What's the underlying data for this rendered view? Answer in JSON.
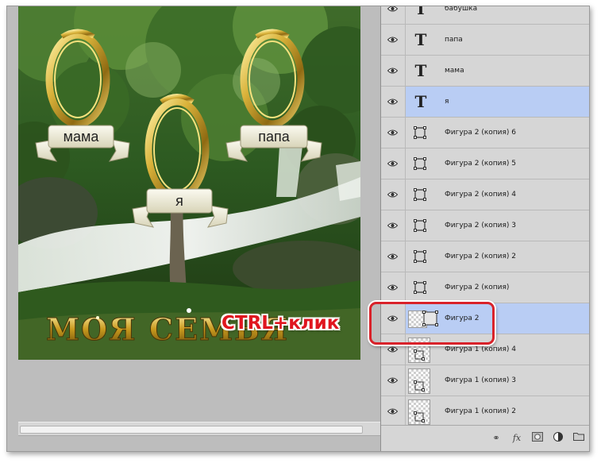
{
  "canvas": {
    "frame_labels": [
      "мама",
      "я",
      "папа"
    ],
    "title_text": "МОЯ СЕМЬЯ"
  },
  "annotation": {
    "shortcut_text": "CTRL+клик"
  },
  "layers": [
    {
      "name": "бабушка",
      "kind": "text",
      "selected": false
    },
    {
      "name": "папа",
      "kind": "text",
      "selected": false
    },
    {
      "name": "мама",
      "kind": "text",
      "selected": false
    },
    {
      "name": "я",
      "kind": "text",
      "selected": true
    },
    {
      "name": "Фигура 2 (копия) 6",
      "kind": "shape",
      "selected": false
    },
    {
      "name": "Фигура 2 (копия) 5",
      "kind": "shape",
      "selected": false
    },
    {
      "name": "Фигура 2 (копия) 4",
      "kind": "shape",
      "selected": false
    },
    {
      "name": "Фигура 2 (копия) 3",
      "kind": "shape",
      "selected": false
    },
    {
      "name": "Фигура 2 (копия) 2",
      "kind": "shape",
      "selected": false
    },
    {
      "name": "Фигура 2 (копия)",
      "kind": "shape",
      "selected": false
    },
    {
      "name": "Фигура 2",
      "kind": "shape-thumb",
      "selected": true
    },
    {
      "name": "Фигура 1 (копия) 4",
      "kind": "image-thumb",
      "selected": false
    },
    {
      "name": "Фигура 1 (копия) 3",
      "kind": "image-thumb",
      "selected": false
    },
    {
      "name": "Фигура 1 (копия) 2",
      "kind": "image-thumb",
      "selected": false
    }
  ],
  "layer_text_glyph": "T",
  "toolbar": {
    "icons": [
      "link-icon",
      "fx-icon",
      "mask-icon",
      "adjustment-icon",
      "folder-icon"
    ],
    "fx_label": "fx"
  },
  "colors": {
    "selection": "#b9cdf4",
    "callout": "#d9222a",
    "gold": "#c9a227"
  }
}
